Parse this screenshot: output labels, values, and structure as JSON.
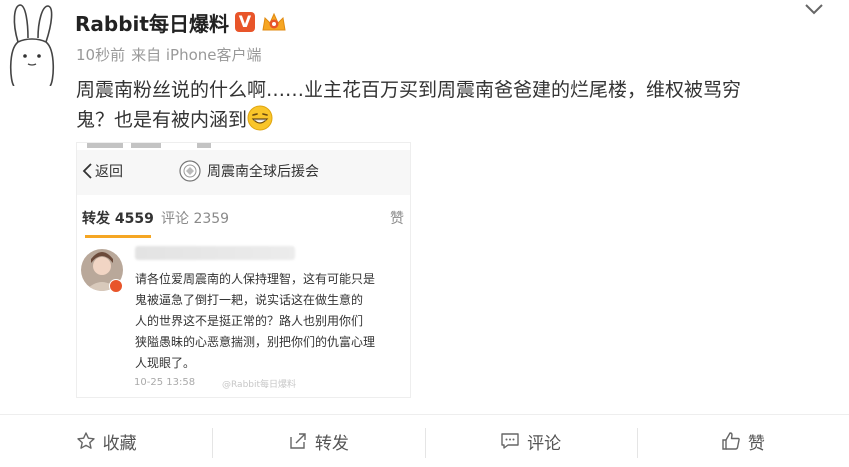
{
  "post": {
    "username": "Rabbit每日爆料",
    "verified_badge": "V",
    "meta": {
      "time": "10秒前",
      "source": "来自 iPhone客户端"
    },
    "text_line1": "周震南粉丝说的什么啊……业主花百万买到周震南爸爸建的烂尾楼，维权被骂穷",
    "text_line2": "鬼？也是有被内涵到",
    "embedded_screenshot": {
      "back_label": "返回",
      "group_name": "周震南全球后援会",
      "tabs": {
        "repost_label": "转发",
        "repost_count": "4559",
        "comment_label": "评论",
        "comment_count": "2359",
        "like_label": "赞"
      },
      "comment_lines": [
        "请各位爱周震南的人保持理智，这有可能只是",
        "鬼被逼急了倒打一耙，说实话这在做生意的",
        "人的世界这不是挺正常的？路人也别用你们",
        "狭隘愚昧的心恶意揣测，别把你们的仇富心理",
        "人现眼了。"
      ],
      "comment_time": "10-25 13:58",
      "watermark": "@Rabbit每日爆料"
    }
  },
  "actions": {
    "favorite": "收藏",
    "repost": "转发",
    "comment": "评论",
    "like": "赞"
  },
  "colors": {
    "accent_orange": "#e8552a",
    "tab_underline": "#f5a623",
    "text_main": "#333333",
    "text_muted": "#999999"
  },
  "icons": [
    "bunny-avatar-icon",
    "verified-icon",
    "crown-badge-icon",
    "chevron-down-icon",
    "grin-emoji-icon",
    "back-chevron-icon",
    "group-logo-icon",
    "star-icon",
    "share-icon",
    "comment-icon",
    "thumbs-up-icon"
  ]
}
